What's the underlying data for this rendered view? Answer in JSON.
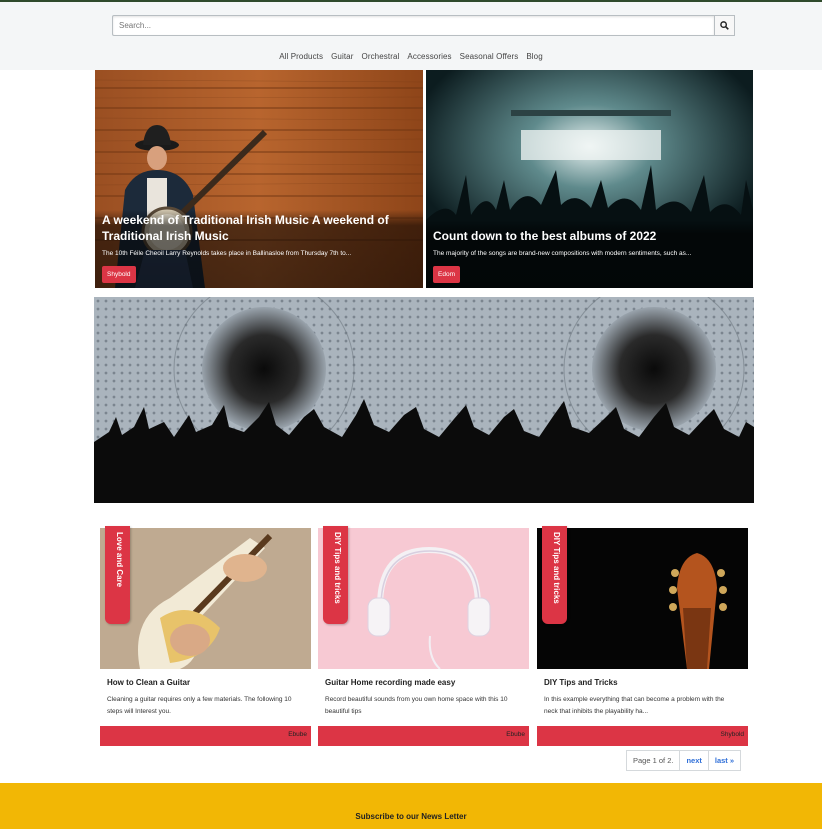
{
  "header": {
    "search_placeholder": "Search...",
    "search_icon": "search-icon",
    "nav": [
      {
        "label": "All Products"
      },
      {
        "label": "Guitar"
      },
      {
        "label": "Orchestral"
      },
      {
        "label": "Accessories"
      },
      {
        "label": "Seasonal Offers"
      },
      {
        "label": "Blog"
      }
    ]
  },
  "featured": [
    {
      "title": "A weekend of Traditional Irish Music A weekend of Traditional Irish Music",
      "excerpt": "The 10th Féile Cheoil Larry Reynolds takes place in Ballinasloe from Thursday 7th to...",
      "author": "Shybold"
    },
    {
      "title": "Count down to the best albums of 2022",
      "excerpt": "The majority of the songs are brand-new compositions with modern sentiments, such as...",
      "author": "Edom"
    }
  ],
  "posts": [
    {
      "category": "Love and Care",
      "title": "How to Clean a Guitar",
      "excerpt": "Cleaning a guitar requires only a few materials. The following 10 steps will Interest you.",
      "author": "Ebube"
    },
    {
      "category": "DIY Tips and tricks",
      "title": "Guitar Home recording made easy",
      "excerpt": "Record beautiful sounds from you own home space with this 10 beautiful tips",
      "author": "Ebube"
    },
    {
      "category": "DIY Tips and tricks",
      "title": "DIY Tips and Tricks",
      "excerpt": "In this example everything that can become a problem with the neck that inhibits the playability ha...",
      "author": "Shybold"
    }
  ],
  "pagination": {
    "status": "Page 1 of 2.",
    "next": "next",
    "last": "last »"
  },
  "footer": {
    "newsletter": "Subscribe to our News Letter"
  },
  "colors": {
    "accent": "#dc3545",
    "footer_bg": "#f2b705",
    "top_border": "#2f4a2c"
  }
}
